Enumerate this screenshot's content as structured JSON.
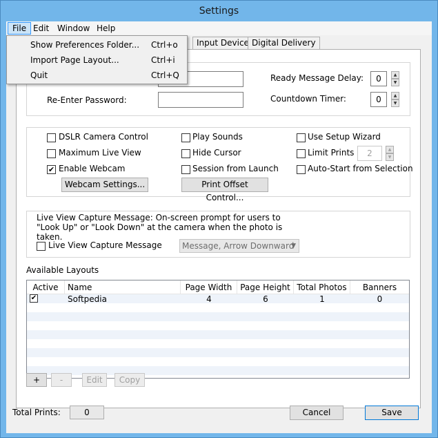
{
  "window": {
    "title": "Settings"
  },
  "menubar": {
    "items": [
      "File",
      "Edit",
      "Window",
      "Help"
    ]
  },
  "file_menu": {
    "items": [
      {
        "label": "Show Preferences Folder...",
        "shortcut": "Ctrl+o"
      },
      {
        "label": "Import Page Layout...",
        "shortcut": "Ctrl+i"
      },
      {
        "label": "Quit",
        "shortcut": "Ctrl+Q"
      }
    ]
  },
  "tabs": [
    "Input Devices",
    "Digital Delivery"
  ],
  "password_group": {
    "reenter_label": "Re-Enter Password:",
    "ready_delay_label": "Ready Message Delay:",
    "ready_delay_value": "0",
    "countdown_label": "Countdown Timer:",
    "countdown_value": "0"
  },
  "options": {
    "dslr": "DSLR Camera Control",
    "max_live": "Maximum Live View",
    "enable_webcam": "Enable Webcam",
    "play_sounds": "Play Sounds",
    "hide_cursor": "Hide Cursor",
    "session_launch": "Session from Launch",
    "setup_wizard": "Use Setup Wizard",
    "limit_prints": "Limit Prints",
    "limit_prints_value": "2",
    "auto_start": "Auto-Start from Selection",
    "webcam_settings_btn": "Webcam Settings...",
    "print_offset_btn": "Print Offset Control..."
  },
  "live_view": {
    "description": "Live View Capture Message: On-screen prompt for users to \"Look Up\" or \"Look Down\" at the camera when the photo is taken.",
    "checkbox_label": "Live View Capture Message",
    "combo_value": "Message, Arrow Downward"
  },
  "layouts": {
    "title": "Available Layouts",
    "columns": [
      "Active",
      "Name",
      "Page Width",
      "Page Height",
      "Total Photos",
      "Banners"
    ],
    "rows": [
      {
        "active": "✔",
        "name": "Softpedia",
        "page_width": "4",
        "page_height": "6",
        "total_photos": "1",
        "banners": "0"
      }
    ],
    "buttons": {
      "add": "+",
      "remove": "-",
      "edit": "Edit",
      "copy": "Copy"
    }
  },
  "footer": {
    "total_prints_label": "Total Prints:",
    "total_prints_value": "0",
    "cancel": "Cancel",
    "save": "Save"
  }
}
